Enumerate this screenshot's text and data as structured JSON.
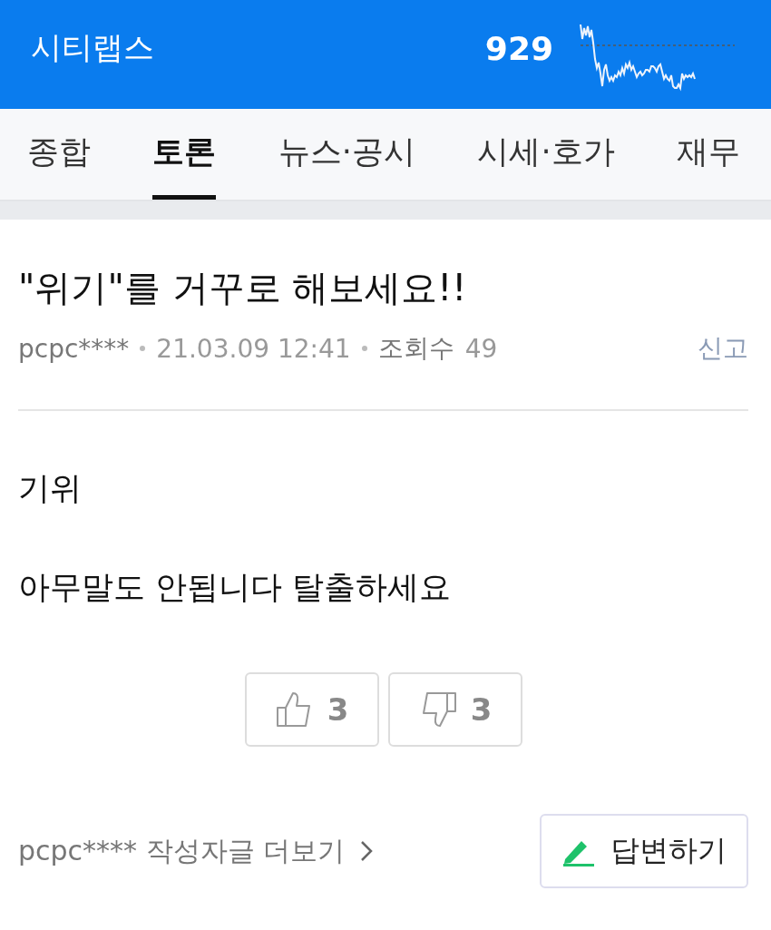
{
  "header": {
    "title": "시티랩스",
    "price": "929"
  },
  "tabs": [
    {
      "label": "종합",
      "selected": false
    },
    {
      "label": "토론",
      "selected": true
    },
    {
      "label": "뉴스·공시",
      "selected": false
    },
    {
      "label": "시세·호가",
      "selected": false
    },
    {
      "label": "재무",
      "selected": false
    }
  ],
  "post": {
    "title": "\"위기\"를 거꾸로 해보세요!!",
    "author": "pcpc****",
    "date": "21.03.09 12:41",
    "views_label": "조회수",
    "views": "49",
    "report": "신고",
    "paragraphs": [
      "기위",
      "아무말도 안됩니다 탈출하세요"
    ],
    "like": "3",
    "dislike": "3"
  },
  "footer": {
    "more": "pcpc**** 작성자글 더보기",
    "reply": "답변하기"
  }
}
